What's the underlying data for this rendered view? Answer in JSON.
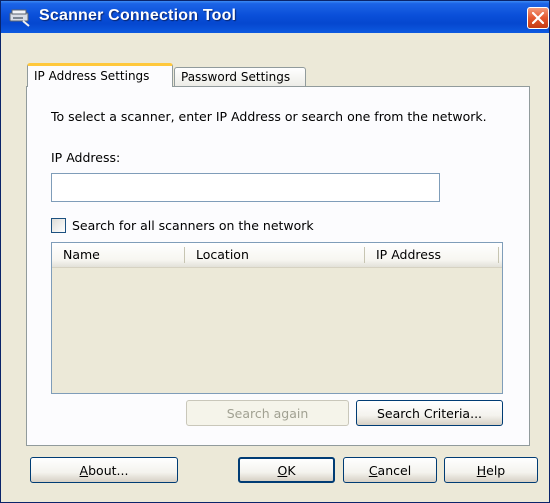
{
  "window": {
    "title": "Scanner Connection Tool"
  },
  "tabs": [
    {
      "label": "IP Address Settings",
      "active": true
    },
    {
      "label": "Password Settings",
      "active": false
    }
  ],
  "ip_tab": {
    "instruction": "To select a scanner, enter IP Address or search one from the network.",
    "ip_label": "IP Address:",
    "ip_value": "",
    "search_all_label": "Search for all scanners on the network",
    "search_all_checked": false,
    "columns": [
      "Name",
      "Location",
      "IP Address"
    ],
    "rows": [],
    "search_again_label": "Search again",
    "search_criteria_label": "Search Criteria..."
  },
  "footer": {
    "about": {
      "mnemonic": "A",
      "rest": "bout..."
    },
    "ok": {
      "mnemonic": "O",
      "rest": "K"
    },
    "cancel": {
      "mnemonic": "C",
      "rest": "ancel"
    },
    "help": {
      "mnemonic": "H",
      "rest": "elp"
    }
  },
  "colors": {
    "titlebar": "#0a4fd9",
    "tab_highlight": "#ffc83c",
    "close_button": "#e4572f",
    "dialog_background": "#ece9d8"
  }
}
